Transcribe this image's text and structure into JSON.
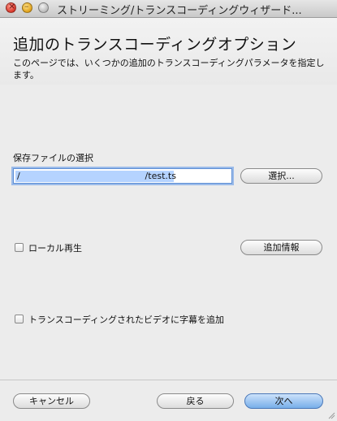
{
  "window": {
    "title": "ストリーミング/トランスコーディングウィザード..."
  },
  "header": {
    "title": "追加のトランスコーディングオプション",
    "description": "このページでは、いくつかの追加のトランスコーディングパラメータを指定します。"
  },
  "save": {
    "label": "保存ファイルの選択",
    "path_value": "/                                            /test.ts",
    "select_button": "選択..."
  },
  "local_play": {
    "label": "ローカル再生",
    "checked": false,
    "extra_button": "追加情報"
  },
  "subtitles": {
    "label": "トランスコーディングされたビデオに字幕を追加",
    "checked": false
  },
  "footer": {
    "cancel": "キャンセル",
    "back": "戻る",
    "next": "次へ"
  },
  "colors": {
    "window_bg": "#ececec",
    "focus_ring": "#9bbbe9",
    "selection": "#b5d3ff",
    "default_button": "#78aee9"
  }
}
